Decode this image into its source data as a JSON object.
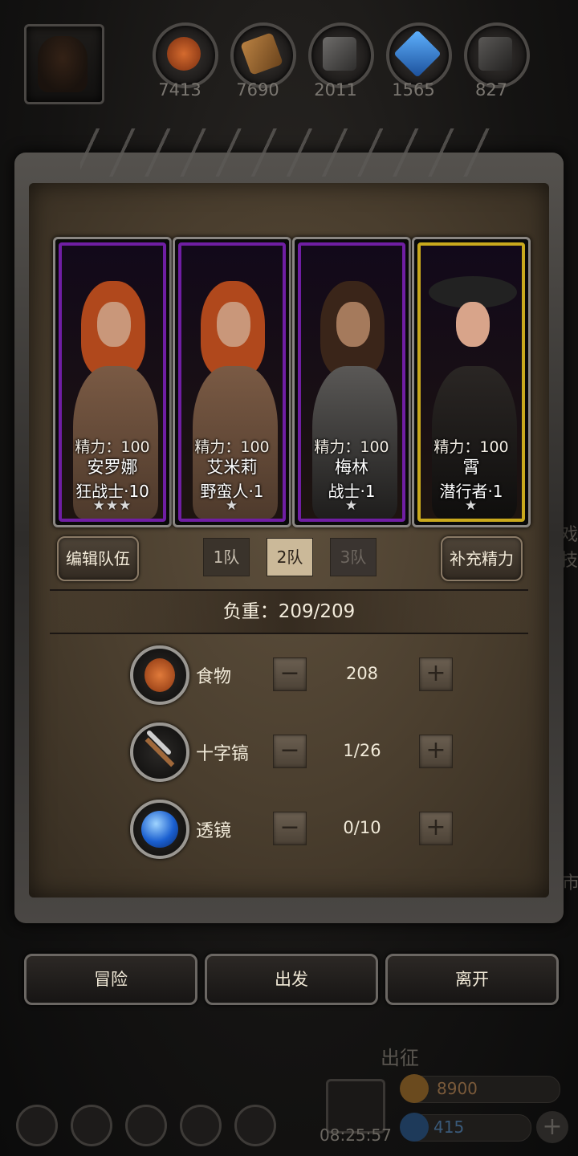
{
  "resources": [
    {
      "icon": "meat-icon",
      "value": "7413",
      "color": "#b8541f"
    },
    {
      "icon": "wood-plank-icon",
      "value": "7690",
      "color": "#9a6a32"
    },
    {
      "icon": "stone-icon",
      "value": "2011",
      "color": "#5a5856"
    },
    {
      "icon": "crystal-icon",
      "value": "1565",
      "color": "#2f7fd0"
    },
    {
      "icon": "iron-ingot-icon",
      "value": "827",
      "color": "#4a4846"
    }
  ],
  "heroes": [
    {
      "stamina": "精力：100",
      "name": "安罗娜",
      "class": "狂战士·10",
      "stars": "★★★",
      "rarity": "purple"
    },
    {
      "stamina": "精力：100",
      "name": "艾米莉",
      "class": "野蛮人·1",
      "stars": "★",
      "rarity": "purple"
    },
    {
      "stamina": "精力：100",
      "name": "梅林",
      "class": "战士·1",
      "stars": "★",
      "rarity": "purple"
    },
    {
      "stamina": "精力：100",
      "name": "霄",
      "class": "潜行者·1",
      "stars": "★",
      "rarity": "gold"
    }
  ],
  "team_controls": {
    "edit_label": "编辑队伍",
    "tabs": [
      "1队",
      "2队",
      "3队"
    ],
    "active_tab": "2队",
    "refill_label": "补充精力"
  },
  "load": {
    "text": "负重：209/209"
  },
  "supplies": [
    {
      "name": "食物",
      "value": "208",
      "icon": "food-icon"
    },
    {
      "name": "十字镐",
      "value": "1/26",
      "icon": "pickaxe-icon"
    },
    {
      "name": "透镜",
      "value": "0/10",
      "icon": "lens-icon"
    }
  ],
  "stepper": {
    "minus": "−",
    "plus": "+"
  },
  "actions": {
    "adventure": "冒险",
    "depart": "出发",
    "leave": "离开"
  },
  "background": {
    "expedition_label": "出征",
    "timer": "08:25:57",
    "gold": "8900",
    "gems": "415",
    "side_text_1": "戏技",
    "side_text_2": "市"
  },
  "colors": {
    "purple_frame": "#6f1ea3",
    "gold_frame": "#c9a91d",
    "active_tab": "#cbb999"
  }
}
